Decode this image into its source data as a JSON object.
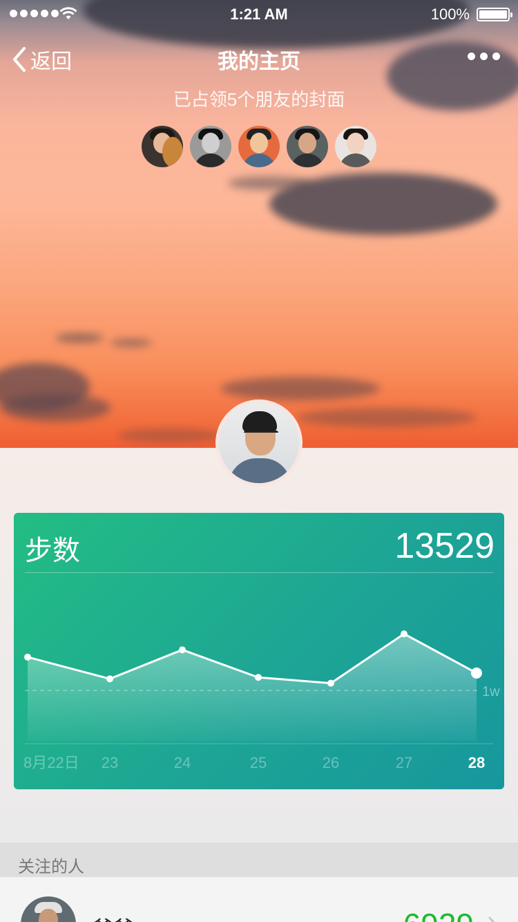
{
  "status_bar": {
    "time": "1:21 AM",
    "battery": "100%",
    "signal_icon": "signal-dots-icon",
    "wifi_icon": "wifi-icon",
    "battery_icon": "battery-icon"
  },
  "nav": {
    "back_label": "返回",
    "title": "我的主页",
    "more_icon": "more-dots-icon"
  },
  "cover": {
    "subtitle": "已占领5个朋友的封面"
  },
  "steps_card": {
    "title": "步数",
    "value": "13529",
    "reference_label": "1w",
    "colors": {
      "start": "#23bd83",
      "end": "#17979d"
    }
  },
  "chart_data": {
    "type": "line",
    "title": "步数",
    "categories": [
      "8月22日",
      "23",
      "24",
      "25",
      "26",
      "27",
      "28"
    ],
    "values": [
      11300,
      9800,
      11800,
      9900,
      9500,
      12900,
      10200
    ],
    "reference_line": 9000,
    "ylim": [
      6000,
      16000
    ],
    "grid": false,
    "highlight_index": 6
  },
  "following": {
    "section_label": "关注的人",
    "items": [
      {
        "name": "爸爸",
        "steps": "6929"
      }
    ],
    "accent_color": "#1bbc2c"
  }
}
